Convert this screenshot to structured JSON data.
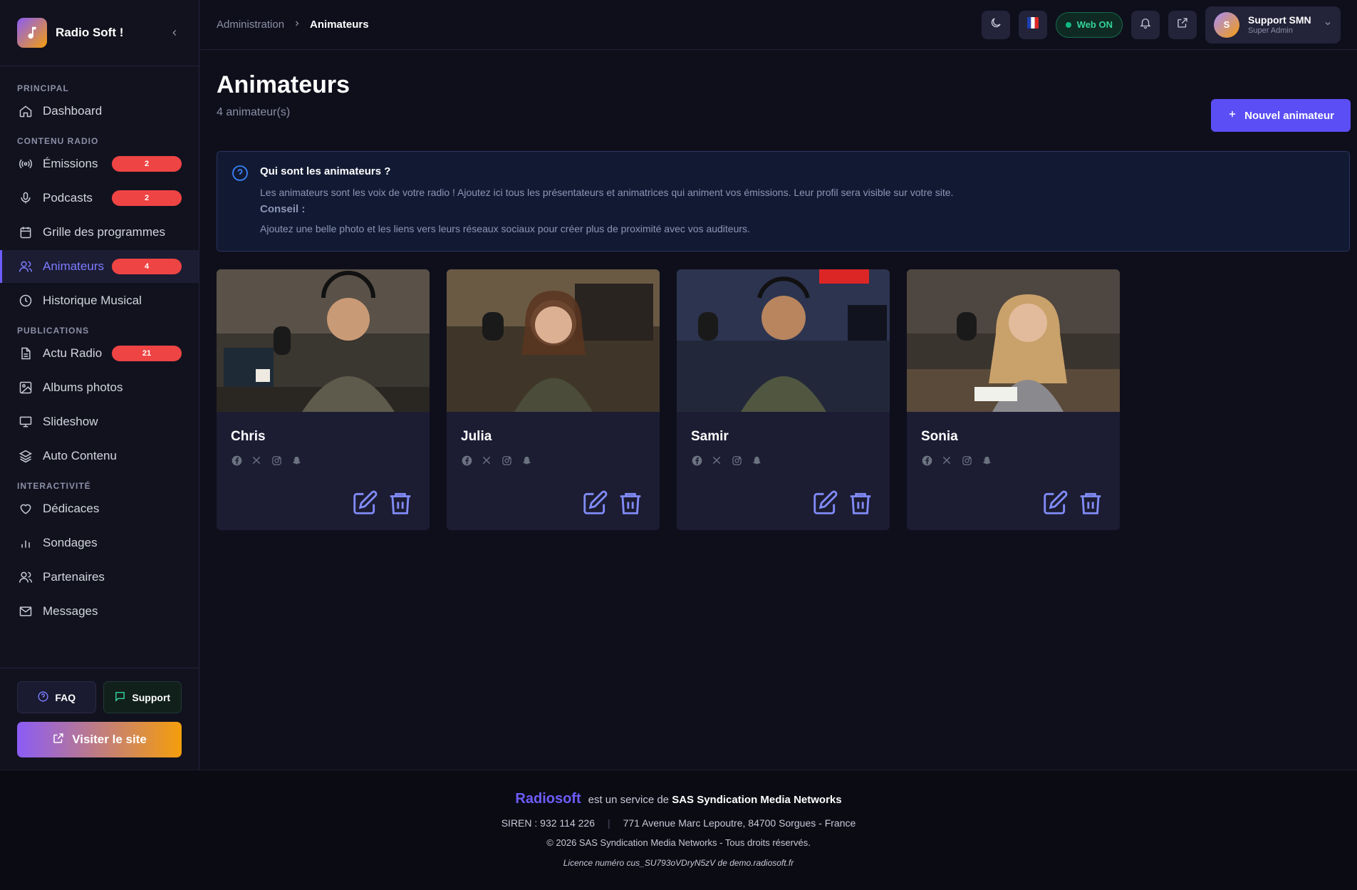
{
  "brand": {
    "name": "Radio Soft !"
  },
  "sidebar": {
    "sections": {
      "principal": "PRINCIPAL",
      "contenu": "CONTENU RADIO",
      "publications": "PUBLICATIONS",
      "interactivite": "INTERACTIVITÉ"
    },
    "items": {
      "dashboard": {
        "label": "Dashboard",
        "icon": "home-icon"
      },
      "emissions": {
        "label": "Émissions",
        "icon": "broadcast-icon",
        "badge": "2"
      },
      "podcasts": {
        "label": "Podcasts",
        "icon": "microphone-icon",
        "badge": "2"
      },
      "grille": {
        "label": "Grille des programmes",
        "icon": "calendar-icon"
      },
      "animateurs": {
        "label": "Animateurs",
        "icon": "users-icon",
        "badge": "4"
      },
      "historique": {
        "label": "Historique Musical",
        "icon": "clock-icon"
      },
      "actu": {
        "label": "Actu Radio",
        "icon": "document-icon",
        "badge": "21"
      },
      "albums": {
        "label": "Albums photos",
        "icon": "image-icon"
      },
      "slideshow": {
        "label": "Slideshow",
        "icon": "monitor-icon"
      },
      "auto": {
        "label": "Auto Contenu",
        "icon": "layers-icon"
      },
      "dedicaces": {
        "label": "Dédicaces",
        "icon": "heart-icon"
      },
      "sondages": {
        "label": "Sondages",
        "icon": "bar-chart-icon"
      },
      "partenaires": {
        "label": "Partenaires",
        "icon": "users-icon"
      },
      "messages": {
        "label": "Messages",
        "icon": "mail-icon"
      }
    },
    "faq": "FAQ",
    "support": "Support",
    "visit": "Visiter le site"
  },
  "header": {
    "breadcrumb_parent": "Administration",
    "breadcrumb_current": "Animateurs",
    "web_status": "Web ON",
    "user_initial": "S",
    "user_name": "Support SMN",
    "user_role": "Super Admin"
  },
  "page": {
    "title": "Animateurs",
    "subtitle": "4 animateur(s)",
    "new_button": "Nouvel animateur"
  },
  "info": {
    "title": "Qui sont les animateurs ?",
    "text": "Les animateurs sont les voix de votre radio ! Ajoutez ici tous les présentateurs et animatrices qui animent vos émissions. Leur profil sera visible sur votre site.",
    "tip_label": "Conseil :",
    "tip": "Ajoutez une belle photo et les liens vers leurs réseaux sociaux pour créer plus de proximité avec vos auditeurs."
  },
  "animateurs": [
    {
      "name": "Chris"
    },
    {
      "name": "Julia"
    },
    {
      "name": "Samir"
    },
    {
      "name": "Sonia"
    }
  ],
  "footer": {
    "brand": "Radiosoft",
    "service_text": "est un service de",
    "company": "SAS Syndication Media Networks",
    "siren": "SIREN : 932 114 226",
    "address": "771 Avenue Marc Lepoutre, 84700 Sorgues - France",
    "copyright": "© 2026 SAS Syndication Media Networks - Tous droits réservés.",
    "licence": "Licence numéro cus_SU793oVDryN5zV de demo.radiosoft.fr"
  },
  "colors": {
    "accent": "#6d5dfc",
    "badge": "#ef4444",
    "web_on": "#34d399",
    "background": "#0f0f1c"
  }
}
